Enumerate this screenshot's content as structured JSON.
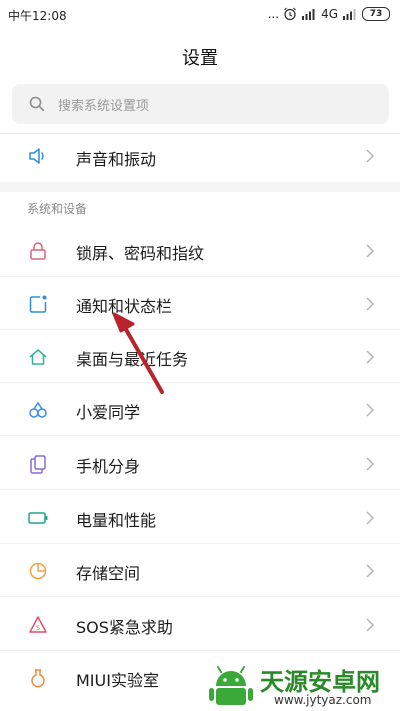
{
  "status_bar": {
    "time": "中午12:08",
    "dots": "...",
    "network": "4G",
    "battery": "73"
  },
  "page": {
    "title": "设置"
  },
  "search": {
    "placeholder": "搜索系统设置项"
  },
  "top_items": [
    {
      "label": "声音和振动",
      "icon": "speaker-icon"
    }
  ],
  "section": {
    "header": "系统和设备"
  },
  "items": [
    {
      "label": "锁屏、密码和指纹",
      "icon": "lock-icon"
    },
    {
      "label": "通知和状态栏",
      "icon": "notification-icon"
    },
    {
      "label": "桌面与最近任务",
      "icon": "home-icon"
    },
    {
      "label": "小爱同学",
      "icon": "xiaoai-icon"
    },
    {
      "label": "手机分身",
      "icon": "clone-icon"
    },
    {
      "label": "电量和性能",
      "icon": "battery-icon"
    },
    {
      "label": "存储空间",
      "icon": "storage-pie-icon"
    },
    {
      "label": "SOS紧急求助",
      "icon": "sos-icon"
    },
    {
      "label": "MIUI实验室",
      "icon": "flask-icon"
    }
  ],
  "watermark": {
    "title": "天源安卓网",
    "url": "www.jytyaz.com"
  },
  "colors": {
    "accent_blue": "#2b8fd6",
    "lock_pink": "#e0607a",
    "home_green": "#2fb39a",
    "xiaoai_blue": "#3a8ee6",
    "clone_purple": "#8a6ad8",
    "battery_green": "#1fa58a",
    "storage_orange": "#f0a24a",
    "sos_red": "#e0506a",
    "flask_orange": "#f08a3a",
    "annotation_arrow": "#b8232e"
  }
}
